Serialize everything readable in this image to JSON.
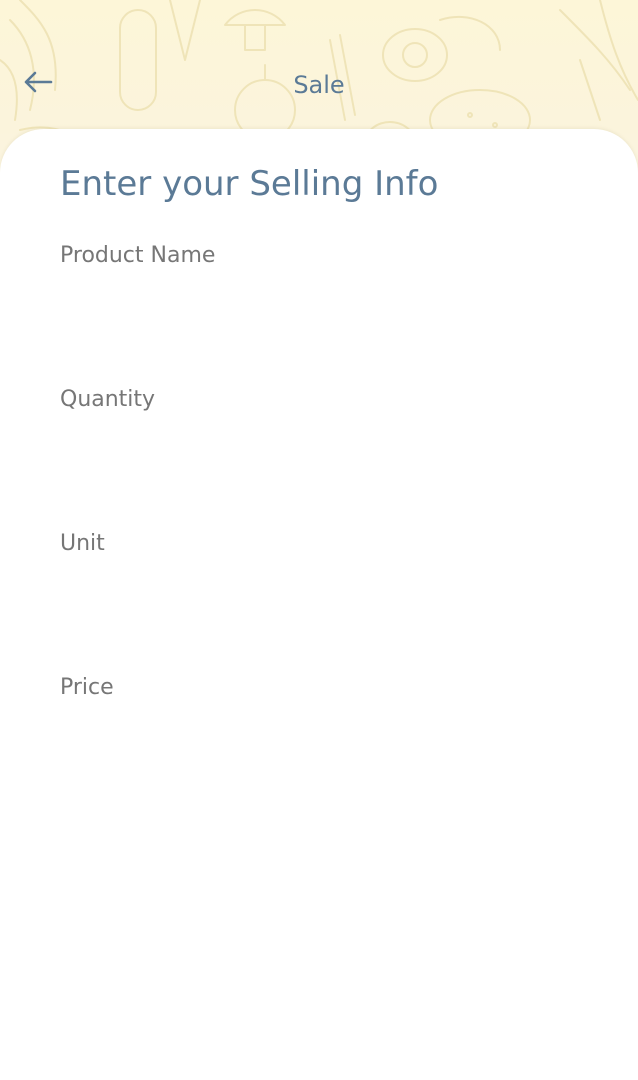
{
  "header": {
    "title": "Sale",
    "back_icon": "arrow-left-icon",
    "background_color": "#fdf6d8",
    "accent_color": "#5b7a96"
  },
  "form": {
    "title": "Enter your Selling Info",
    "fields": [
      {
        "label": "Product Name",
        "value": ""
      },
      {
        "label": "Quantity",
        "value": ""
      },
      {
        "label": "Unit",
        "value": ""
      },
      {
        "label": "Price",
        "value": ""
      }
    ]
  }
}
